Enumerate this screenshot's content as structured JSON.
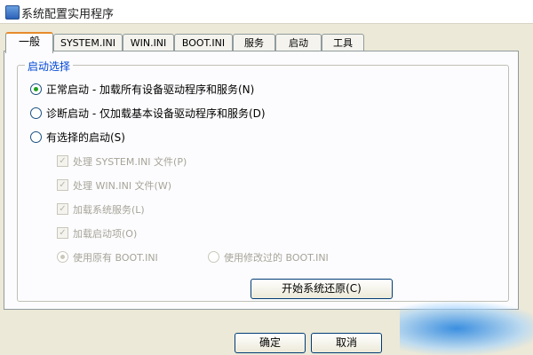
{
  "window": {
    "title": "系统配置实用程序",
    "icon": "msconfig-icon"
  },
  "tabs": [
    {
      "label": "一般"
    },
    {
      "label": "SYSTEM.INI"
    },
    {
      "label": "WIN.INI"
    },
    {
      "label": "BOOT.INI"
    },
    {
      "label": "服务"
    },
    {
      "label": "启动"
    },
    {
      "label": "工具"
    }
  ],
  "startup": {
    "legend": "启动选择",
    "normal": "正常启动 - 加载所有设备驱动程序和服务(N)",
    "diagnostic": "诊断启动 - 仅加载基本设备驱动程序和服务(D)",
    "selective": "有选择的启动(S)",
    "selected": "normal",
    "options": [
      {
        "label": "处理 SYSTEM.INI 文件(P)",
        "checked": true
      },
      {
        "label": "处理 WIN.INI 文件(W)",
        "checked": true
      },
      {
        "label": "加载系统服务(L)",
        "checked": true
      },
      {
        "label": "加载启动项(O)",
        "checked": true
      }
    ],
    "boot_original": "使用原有 BOOT.INI",
    "boot_modified": "使用修改过的 BOOT.INI"
  },
  "buttons": {
    "restore": "开始系统还原(C)",
    "ok": "确定",
    "cancel": "取消"
  },
  "colors": {
    "accent": "#e68b2c",
    "group_title": "#0046d5",
    "radio_dot": "#21a121"
  }
}
